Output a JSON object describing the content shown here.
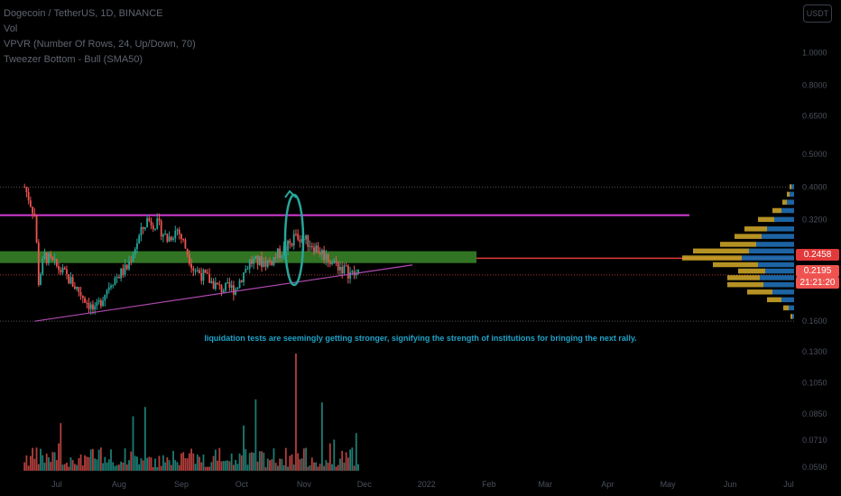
{
  "header": {
    "symbol": "Dogecoin / TetherUS, 1D, BINANCE",
    "indicator_vol": "Vol",
    "indicator_vpvr": "VPVR (Number Of Rows, 24, Up/Down, 70)",
    "indicator_tweezer": "Tweezer Bottom - Bull (SMA50)"
  },
  "axis_button": "USDT",
  "annotation": "liquidation tests are seemingly getting stronger, signifying the strength of institutions for bringing the next rally.",
  "price_tags": {
    "level": "0.2458",
    "last": "0.2195",
    "countdown": "21:21:20"
  },
  "colors": {
    "background": "#000000",
    "up": "#26a69a",
    "down": "#ef5350",
    "resistance": "#d63ad6",
    "support_zone": "#3a8a2a",
    "level_line": "#e23a3a",
    "trendline": "#b04ab0",
    "annotation": "#1fa3c9",
    "vpvr_up": "#1f6fb5",
    "vpvr_down": "#c9a227"
  },
  "chart_data": {
    "type": "candlestick",
    "scale": "log",
    "y_ticks": [
      "1.0000",
      "0.8000",
      "0.6500",
      "0.5000",
      "0.4000",
      "0.3200",
      "0.2458",
      "0.2195",
      "0.1600",
      "0.1300",
      "0.1050",
      "0.0850",
      "0.0710",
      "0.0590"
    ],
    "x_ticks": [
      "Jul",
      "Aug",
      "Sep",
      "Oct",
      "Nov",
      "Dec",
      "2022",
      "Feb",
      "Mar",
      "Apr",
      "May",
      "Jun",
      "Jul"
    ],
    "ylim": [
      0.058,
      1.08
    ],
    "approx_close_path": [
      [
        "2021-06-15",
        0.4
      ],
      [
        "2021-06-20",
        0.33
      ],
      [
        "2021-06-22",
        0.21
      ],
      [
        "2021-06-25",
        0.25
      ],
      [
        "2021-07-05",
        0.22
      ],
      [
        "2021-07-20",
        0.17
      ],
      [
        "2021-07-28",
        0.21
      ],
      [
        "2021-08-05",
        0.23
      ],
      [
        "2021-08-15",
        0.32
      ],
      [
        "2021-08-20",
        0.31
      ],
      [
        "2021-08-25",
        0.28
      ],
      [
        "2021-08-30",
        0.3
      ],
      [
        "2021-09-07",
        0.23
      ],
      [
        "2021-09-20",
        0.2
      ],
      [
        "2021-09-28",
        0.2
      ],
      [
        "2021-10-05",
        0.24
      ],
      [
        "2021-10-15",
        0.24
      ],
      [
        "2021-10-25",
        0.27
      ],
      [
        "2021-10-28",
        0.29
      ],
      [
        "2021-11-05",
        0.27
      ],
      [
        "2021-11-15",
        0.24
      ],
      [
        "2021-11-25",
        0.22
      ],
      [
        "2021-11-28",
        0.2195
      ]
    ],
    "levels": {
      "resistance": 0.33,
      "support_zone": [
        0.238,
        0.258
      ],
      "red_level": 0.2458,
      "trendline_start": [
        "2021-06-20",
        0.16
      ],
      "trendline_end": [
        "2021-12-25",
        0.235
      ]
    },
    "volume_peak_date": "2021-10-28",
    "vpvr_rows": [
      {
        "price": 0.4,
        "up": 3,
        "down": 2
      },
      {
        "price": 0.38,
        "up": 5,
        "down": 3
      },
      {
        "price": 0.36,
        "up": 8,
        "down": 5
      },
      {
        "price": 0.34,
        "up": 14,
        "down": 10
      },
      {
        "price": 0.32,
        "up": 22,
        "down": 18
      },
      {
        "price": 0.3,
        "up": 30,
        "down": 25
      },
      {
        "price": 0.285,
        "up": 36,
        "down": 30
      },
      {
        "price": 0.27,
        "up": 42,
        "down": 40
      },
      {
        "price": 0.258,
        "up": 50,
        "down": 62
      },
      {
        "price": 0.246,
        "up": 58,
        "down": 66
      },
      {
        "price": 0.235,
        "up": 40,
        "down": 50
      },
      {
        "price": 0.225,
        "up": 32,
        "down": 30
      },
      {
        "price": 0.215,
        "up": 38,
        "down": 36
      },
      {
        "price": 0.205,
        "up": 34,
        "down": 40
      },
      {
        "price": 0.195,
        "up": 24,
        "down": 28
      },
      {
        "price": 0.185,
        "up": 14,
        "down": 16
      },
      {
        "price": 0.175,
        "up": 6,
        "down": 6
      },
      {
        "price": 0.165,
        "up": 2,
        "down": 2
      }
    ]
  }
}
